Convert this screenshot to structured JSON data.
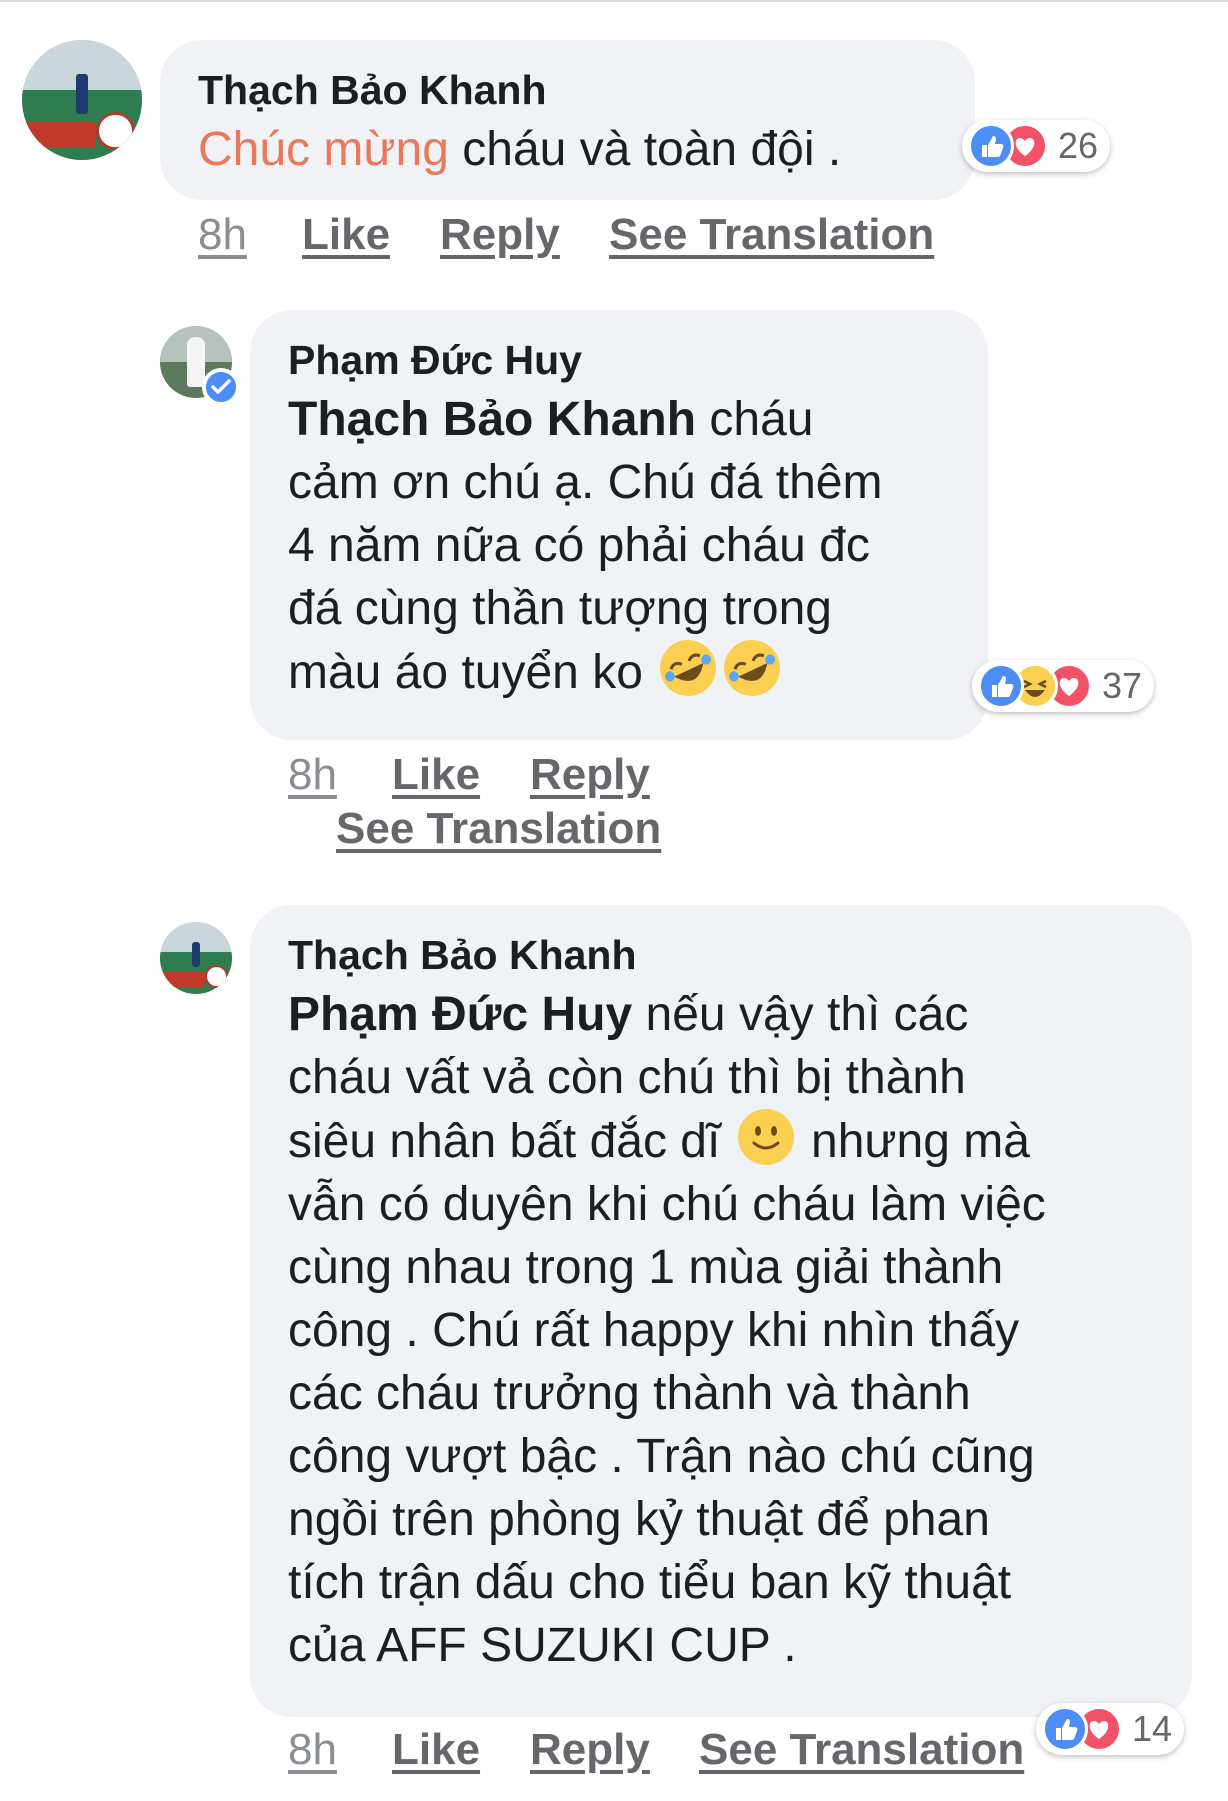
{
  "comments": [
    {
      "author": "Thạch Bảo Khanh",
      "tagged": "Chúc mừng",
      "text": " cháu và toàn đội .",
      "reaction_count": "26",
      "time": "8h",
      "like": "Like",
      "reply": "Reply",
      "translate": "See Translation"
    },
    {
      "author": "Phạm Đức Huy",
      "mention": "Thạch Bảo Khanh",
      "line1": " cháu",
      "line2": "cảm ơn chú ạ. Chú đá thêm",
      "line3": "4 năm nữa có phải cháu đc",
      "line4": "đá cùng thần tượng trong",
      "line5": "màu áo tuyển ko",
      "reaction_count": "37",
      "time": "8h",
      "like": "Like",
      "reply": "Reply",
      "translate": "See Translation"
    },
    {
      "author": "Thạch Bảo Khanh",
      "mention": "Phạm Đức Huy",
      "line1": " nếu  vậy thì  các",
      "line2": "cháu vất vả còn chú thì bị thành",
      "line3a": "siêu nhân bất đắc dĩ ",
      "line3b": " nhưng mà",
      "line4": "vẫn có duyên khi chú cháu  làm việc",
      "line5": "cùng  nhau trong 1 mùa giải thành",
      "line6": "công . Chú rất happy khi nhìn thấy",
      "line7": "các cháu trưởng thành và thành",
      "line8": "công vượt bậc . Trận nào chú cũng",
      "line9": "ngồi trên phòng kỷ thuật để phan",
      "line10": "tích trận dấu cho tiểu ban kỹ thuật",
      "line11": "của AFF SUZUKI CUP .",
      "reaction_count": "14",
      "time": "8h",
      "like": "Like",
      "reply": "Reply",
      "translate": "See Translation"
    }
  ],
  "icons": {
    "like": "like-reaction-icon",
    "love": "love-reaction-icon",
    "haha": "haha-reaction-icon",
    "verified": "verified-badge-icon",
    "rofl": "rofl-emoji",
    "smile": "slight-smile-emoji"
  },
  "colors": {
    "bubble": "#f0f2f5",
    "tag": "#e9795b",
    "like": "#4c8df6",
    "love": "#f25268",
    "haha": "#fbcf4f",
    "meta": "#65676b"
  }
}
